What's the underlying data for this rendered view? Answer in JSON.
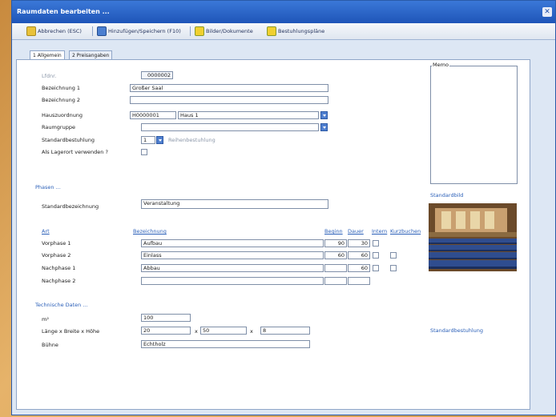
{
  "window": {
    "title": "Raumdaten bearbeiten ..."
  },
  "toolbar": {
    "exit_label": "Abbrechen (ESC)",
    "save_label": "Hinzufügen/Speichern (F10)",
    "docs_label": "Bilder/Dokumente",
    "plan_label": "Bestuhlungspläne"
  },
  "tabs": [
    {
      "label": "1 Allgemein"
    },
    {
      "label": "2 Preisangaben"
    }
  ],
  "form": {
    "lfdnr": {
      "label": "Lfdnr.",
      "value": "0000002"
    },
    "bez1": {
      "label": "Bezeichnung 1",
      "value": "Großer Saal"
    },
    "bez2": {
      "label": "Bezeichnung 2",
      "value": ""
    },
    "haus": {
      "label": "Hauszuordnung",
      "code": "H0000001",
      "name": "Haus 1"
    },
    "raumgruppe": {
      "label": "Raumgruppe",
      "value": ""
    },
    "standardbestuhlung": {
      "label": "Standardbestuhlung",
      "value": "1",
      "name": "Reihenbestuhlung"
    },
    "lagerort": {
      "label": "Als Lagerort verwenden ?"
    }
  },
  "memo": {
    "label": "Memo"
  },
  "phasen": {
    "heading": "Phasen ...",
    "standard_label": "Standardbezeichnung",
    "standard_value": "Veranstaltung",
    "col_art": "Art",
    "col_bez": "Bezeichnung",
    "col_beginn": "Beginn",
    "col_dauer": "Dauer",
    "col_intern": "Intern",
    "col_kurz": "Kurzbuchen",
    "rows": [
      {
        "label": "Vorphase 1",
        "bez": "Aufbau",
        "beginn": "90",
        "dauer": "30"
      },
      {
        "label": "Vorphase 2",
        "bez": "Einlass",
        "beginn": "60",
        "dauer": "60"
      },
      {
        "label": "Nachphase 1",
        "bez": "Abbau",
        "beginn": "",
        "dauer": "60"
      },
      {
        "label": "Nachphase 2",
        "bez": "",
        "beginn": "",
        "dauer": ""
      }
    ]
  },
  "standardbild": {
    "label": "Standardbild"
  },
  "technik": {
    "heading": "Technische Daten ...",
    "qm_label": "m²",
    "qm_value": "100",
    "lbh_label": "Länge x Breite x Höhe",
    "laenge": "20",
    "breite": "50",
    "hoehe": "8",
    "x1": "x",
    "x2": "x",
    "buehne_label": "Bühne",
    "buehne_value": "Echtholz"
  },
  "standardbestuhlung_right": {
    "label": "Standardbestuhlung"
  },
  "colors": {
    "accent": "#2a5fb8",
    "titlebar": "#1f55b8",
    "panel_bg": "#dde7f4"
  }
}
